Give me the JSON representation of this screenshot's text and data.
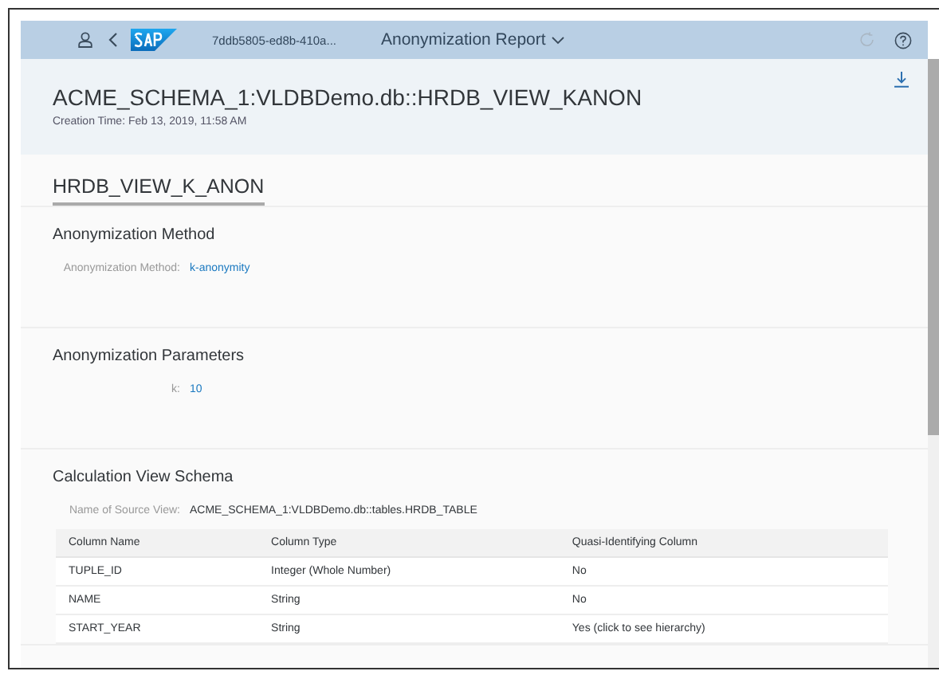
{
  "shell": {
    "app_id": "7ddb5805-ed8b-410a...",
    "title": "Anonymization Report"
  },
  "header": {
    "title": "ACME_SCHEMA_1:VLDBDemo.db::HRDB_VIEW_KANON",
    "creation_time": "Creation Time: Feb 13, 2019, 11:58 AM"
  },
  "tabs": [
    {
      "label": "HRDB_VIEW_K_ANON",
      "selected": true
    }
  ],
  "sections": [
    {
      "title": "Anonymization Method",
      "fields": [
        {
          "label": "Anonymization Method:",
          "value": "k-anonymity",
          "link": true
        }
      ]
    },
    {
      "title": "Anonymization Parameters",
      "fields": [
        {
          "label": "k:",
          "value": "10",
          "link": true
        }
      ]
    },
    {
      "title": "Calculation View Schema",
      "fields": [
        {
          "label": "Name of Source View:",
          "value": "ACME_SCHEMA_1:VLDBDemo.db::tables.HRDB_TABLE",
          "link": false
        }
      ],
      "table": {
        "columns": [
          "Column Name",
          "Column Type",
          "Quasi-Identifying Column"
        ],
        "rows": [
          [
            "TUPLE_ID",
            "Integer (Whole Number)",
            "No"
          ],
          [
            "NAME",
            "String",
            "No"
          ],
          [
            "START_YEAR",
            "String",
            "Yes (click to see hierarchy)"
          ]
        ]
      }
    }
  ]
}
